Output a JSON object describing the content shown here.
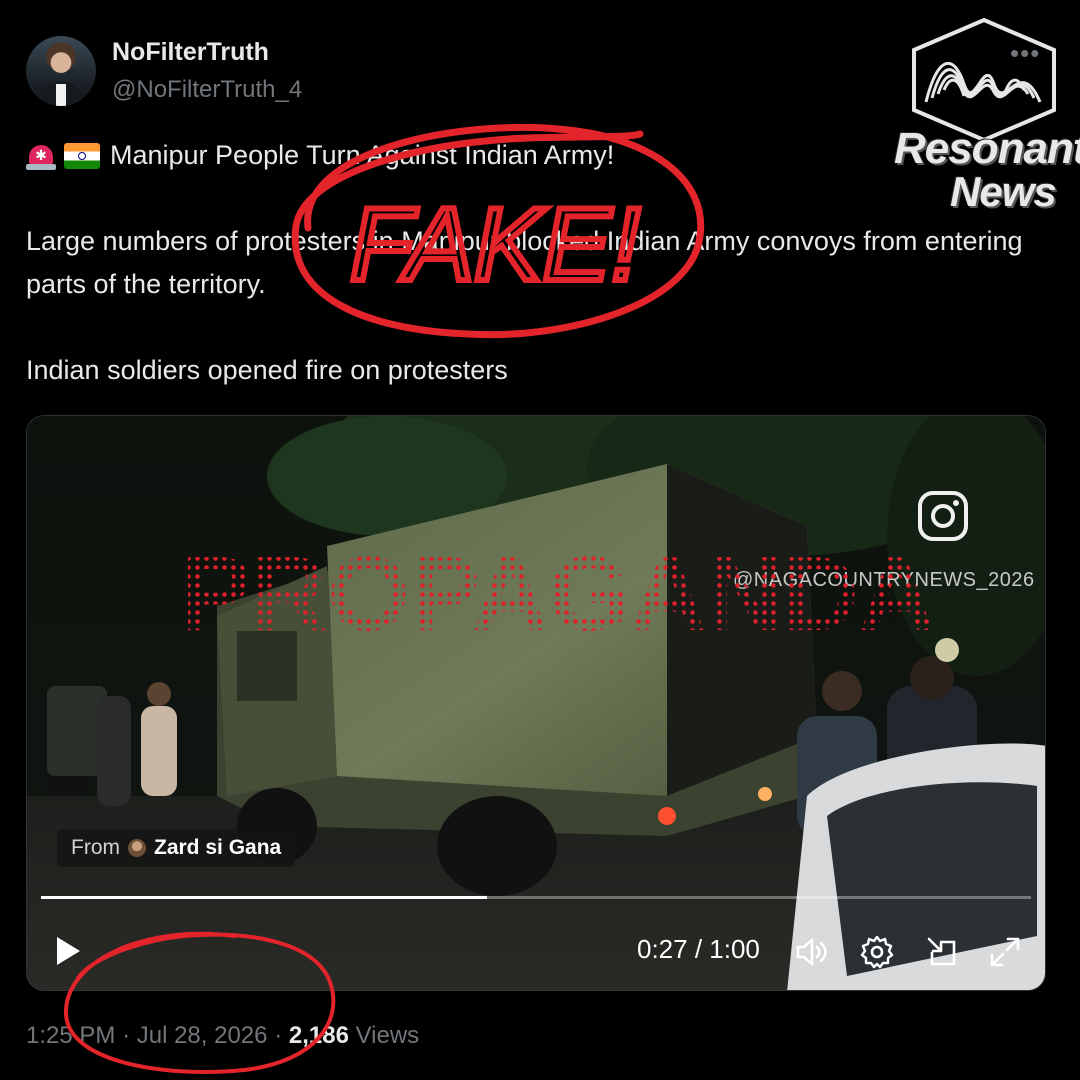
{
  "author": {
    "display_name": "NoFilterTruth",
    "handle": "@NoFilterTruth_4"
  },
  "logo": {
    "line1": "Resonant",
    "line2": "News"
  },
  "tweet": {
    "headline": "Manipur People Turn Against Indian Army!",
    "paragraph1": "Large numbers of protesters in Manipur blocked Indian Army convoys from entering parts of the territory.",
    "paragraph2": "Indian soldiers opened fire on protesters"
  },
  "overlays": {
    "fake_stamp": "FAKE!",
    "propaganda_stamp": "PROPAGANDA"
  },
  "video": {
    "watermark_handle": "@NAGACOUNTRYNEWS_2026",
    "from_label": "From",
    "from_name": "Zard si Gana",
    "time": "0:27 / 1:00",
    "progress": 0.45
  },
  "footer": {
    "time": "1:25 PM",
    "separator": "·",
    "date": "Jul 28, 2026",
    "views_count": "2,186",
    "views_label": "Views"
  },
  "colors": {
    "background": "#000000",
    "text_primary": "#e7e9ea",
    "text_secondary": "#71767b",
    "annotation_red": "#e3242b"
  },
  "icons": [
    "more-icon",
    "siren-emoji",
    "india-flag-emoji",
    "instagram-icon",
    "play-icon",
    "volume-icon",
    "settings-icon",
    "pip-icon",
    "fullscreen-icon"
  ]
}
